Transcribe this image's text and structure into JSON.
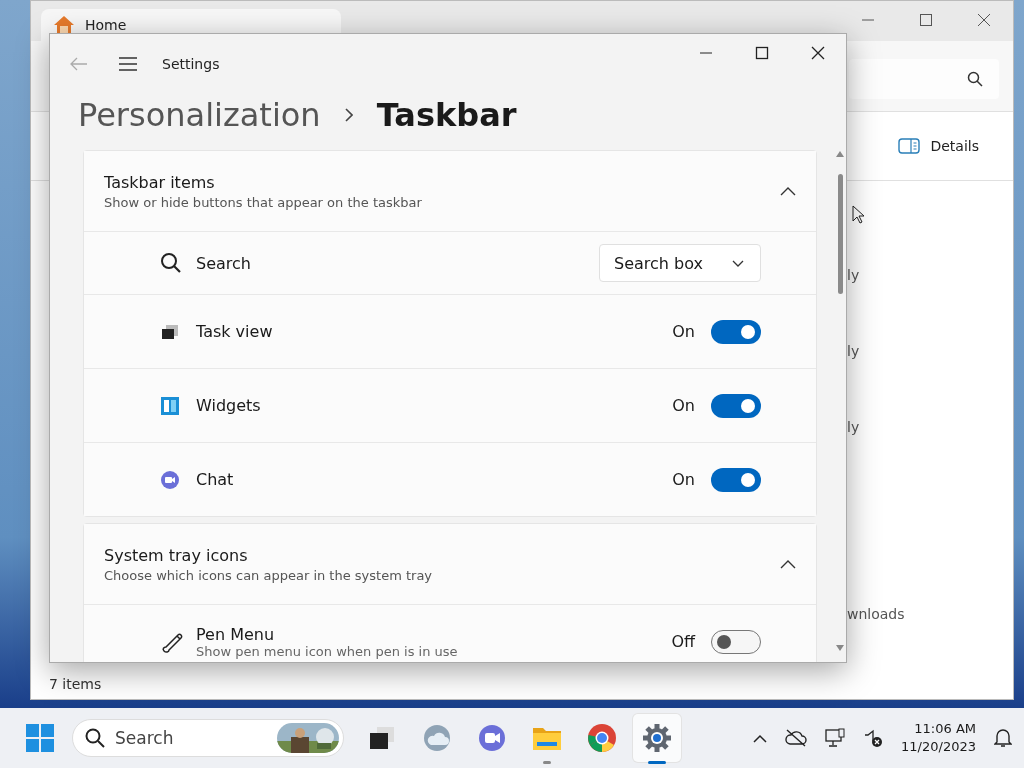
{
  "explorer": {
    "tab": {
      "label": "Home"
    },
    "details_button": "Details",
    "list_fragments": [
      "ly",
      "ly",
      "ly",
      "wnloads"
    ],
    "status_bar": "7 items"
  },
  "settings": {
    "title": "Settings",
    "breadcrumb": [
      "Personalization",
      "Taskbar"
    ],
    "sections": [
      {
        "title": "Taskbar items",
        "subtitle": "Show or hide buttons that appear on the taskbar",
        "expanded": true,
        "rows": [
          {
            "kind": "dropdown",
            "label": "Search",
            "value": "Search box"
          },
          {
            "kind": "toggle",
            "label": "Task view",
            "state": "On",
            "on": true
          },
          {
            "kind": "toggle",
            "label": "Widgets",
            "state": "On",
            "on": true
          },
          {
            "kind": "toggle",
            "label": "Chat",
            "state": "On",
            "on": true
          }
        ]
      },
      {
        "title": "System tray icons",
        "subtitle": "Choose which icons can appear in the system tray",
        "expanded": true,
        "rows": [
          {
            "kind": "toggle",
            "label": "Pen Menu",
            "description": "Show pen menu icon when pen is in use",
            "state": "Off",
            "on": false
          }
        ]
      }
    ]
  },
  "taskbar": {
    "search_placeholder": "Search",
    "apps": [
      {
        "running": false,
        "selected": false
      },
      {
        "running": false,
        "selected": false
      },
      {
        "running": false,
        "selected": false
      },
      {
        "running": true,
        "selected": false
      },
      {
        "running": false,
        "selected": false
      },
      {
        "running": true,
        "selected": true
      }
    ],
    "time": "11:06 AM",
    "date": "11/20/2023"
  }
}
